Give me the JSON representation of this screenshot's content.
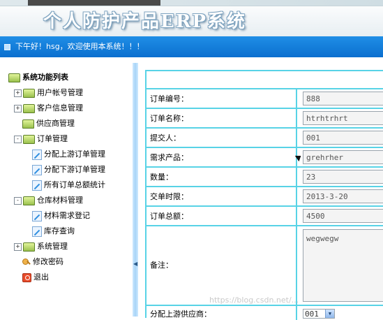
{
  "app": {
    "title": "个人防护产品ERP系统",
    "welcome": "下午好！hsg，欢迎使用本系统！！！"
  },
  "sidebar": {
    "root": "系统功能列表",
    "items": [
      {
        "label": "用户帐号管理",
        "icon": "folder-icon",
        "expander": "+"
      },
      {
        "label": "客户信息管理",
        "icon": "folder-icon",
        "expander": "+"
      },
      {
        "label": "供应商管理",
        "icon": "folder-icon"
      },
      {
        "label": "订单管理",
        "icon": "folder-icon",
        "expander": "-"
      },
      {
        "label": "分配上游订单管理",
        "icon": "doc-icon"
      },
      {
        "label": "分配下游订单管理",
        "icon": "doc-icon"
      },
      {
        "label": "所有订单总额统计",
        "icon": "doc-icon"
      },
      {
        "label": "仓库材料管理",
        "icon": "folder-icon",
        "expander": "-"
      },
      {
        "label": "材料需求登记",
        "icon": "doc-icon"
      },
      {
        "label": "库存查询",
        "icon": "doc-icon"
      },
      {
        "label": "系统管理",
        "icon": "folder-icon",
        "expander": "+"
      },
      {
        "label": "修改密码",
        "icon": "key-icon"
      },
      {
        "label": "退出",
        "icon": "exit-icon"
      }
    ]
  },
  "form": {
    "fields": [
      {
        "label": "订单编号：",
        "value": "888"
      },
      {
        "label": "订单名称：",
        "value": "htrhtrhrt"
      },
      {
        "label": "提交人：",
        "value": "001"
      },
      {
        "label": "需求产品：",
        "value": "grehrher"
      },
      {
        "label": "数量：",
        "value": "23"
      },
      {
        "label": "交单时限：",
        "value": "2013-3-20"
      },
      {
        "label": "订单总额：",
        "value": "4500"
      }
    ],
    "remark": {
      "label": "备注：",
      "value": "wegwegw"
    },
    "supplier": {
      "label": "分配上游供应商：",
      "value": "001"
    }
  },
  "watermark": "https://blog.csdn.net/..."
}
